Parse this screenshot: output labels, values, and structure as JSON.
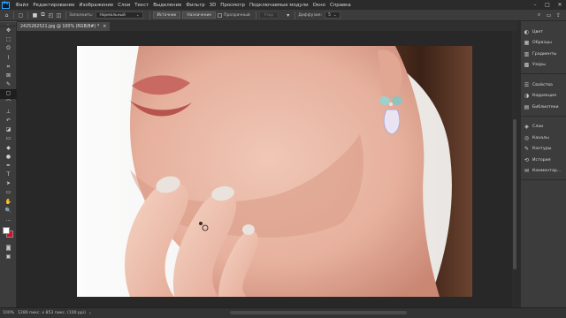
{
  "app": {
    "logo": "Ps"
  },
  "menu": {
    "items": [
      "Файл",
      "Редактирование",
      "Изображение",
      "Слои",
      "Текст",
      "Выделение",
      "Фильтр",
      "3D",
      "Просмотр",
      "Подключаемые модули",
      "Окно",
      "Справка"
    ],
    "window_controls": [
      "–",
      "□",
      "✕"
    ]
  },
  "options": {
    "fill_label": "Заполнить:",
    "fill_mode": "Нормальный",
    "source_button": "Источник",
    "pattern_button": "Назначение",
    "transparent_label": "Прозрачный",
    "pattern_disabled": "Узор",
    "diffusion_label": "Диффузия:",
    "diffusion_value": "5"
  },
  "tools": {
    "icons": [
      "move-icon",
      "marquee-icon",
      "lasso-icon",
      "quick-select-icon",
      "crop-icon",
      "frame-icon",
      "eyedropper-icon",
      "patch-icon",
      "brush-icon",
      "clone-stamp-icon",
      "history-brush-icon",
      "eraser-icon",
      "gradient-icon",
      "blur-icon",
      "dodge-icon",
      "pen-icon",
      "type-icon",
      "path-select-icon",
      "rectangle-icon",
      "hand-icon",
      "zoom-icon",
      "more-tools-icon"
    ],
    "glyphs": [
      "✥",
      "⬚",
      "ʘ",
      "⌇",
      "⌗",
      "⊠",
      "✎",
      "▢",
      "⌒",
      "⊥",
      "↶",
      "◪",
      "▭",
      "◆",
      "●",
      "✒",
      "T",
      "➤",
      "▭",
      "✋",
      "🔍",
      "…"
    ],
    "active_index": 7,
    "foreground_color": "#ffffff",
    "background_color": "#d10f2a"
  },
  "document": {
    "tab_title": "2425262521.jpg @ 100% (RGB/8#) *",
    "close_glyph": "✕"
  },
  "panels": {
    "group1": [
      {
        "icon": "color-icon",
        "glyph": "◐",
        "label": "Цвет"
      },
      {
        "icon": "swatches-icon",
        "glyph": "▦",
        "label": "Образцы"
      },
      {
        "icon": "gradients-icon",
        "glyph": "▥",
        "label": "Градиенты"
      },
      {
        "icon": "patterns-icon",
        "glyph": "▩",
        "label": "Узоры"
      }
    ],
    "group2": [
      {
        "icon": "properties-icon",
        "glyph": "☰",
        "label": "Свойства"
      },
      {
        "icon": "adjustments-icon",
        "glyph": "◑",
        "label": "Коррекция"
      },
      {
        "icon": "libraries-icon",
        "glyph": "▤",
        "label": "Библиотеки"
      }
    ],
    "group3": [
      {
        "icon": "layers-icon",
        "glyph": "◈",
        "label": "Слои"
      },
      {
        "icon": "channels-icon",
        "glyph": "◎",
        "label": "Каналы"
      },
      {
        "icon": "paths-icon",
        "glyph": "✎",
        "label": "Контуры"
      },
      {
        "icon": "history-icon",
        "glyph": "⟲",
        "label": "История"
      },
      {
        "icon": "comments-icon",
        "glyph": "✉",
        "label": "Комментар…"
      }
    ]
  },
  "status": {
    "zoom": "100%",
    "doc_info": "1280 пикс. x 853 пикс. (100 ppi)",
    "arrow": "›"
  }
}
